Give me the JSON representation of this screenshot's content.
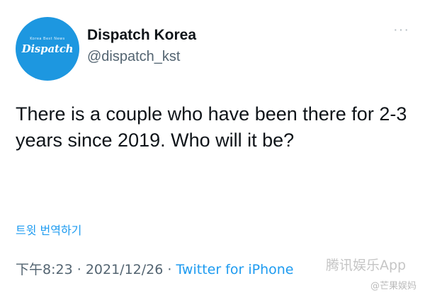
{
  "author": {
    "avatar_small_text": "Korea Best News",
    "avatar_text": "Dispatch",
    "display_name": "Dispatch Korea",
    "handle": "@dispatch_kst"
  },
  "menu": {
    "more_label": "···"
  },
  "tweet": {
    "text": "There is a couple who have been there for 2-3 years since 2019. Who will it be?",
    "translate_label": "트윗 번역하기",
    "time": "下午8:23",
    "separator": "·",
    "date": "2021/12/26",
    "source": "Twitter for iPhone"
  },
  "watermarks": {
    "app": "腾讯娱乐App",
    "weibo": "@芒果娱妈"
  },
  "colors": {
    "link": "#1d9bf0",
    "secondary_text": "#536471",
    "avatar_bg": "#1d97e0"
  },
  "icons": {
    "more": "more-horizontal-icon"
  }
}
